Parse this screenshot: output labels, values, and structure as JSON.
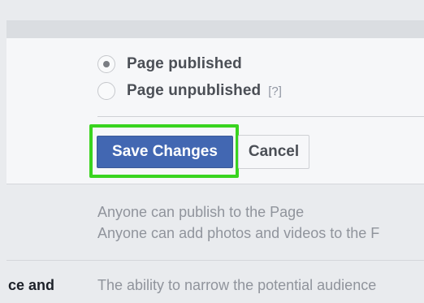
{
  "publish_setting": {
    "options": [
      {
        "label": "Page published",
        "selected": true
      },
      {
        "label": "Page unpublished",
        "selected": false,
        "help": "[?]"
      }
    ]
  },
  "actions": {
    "save_label": "Save Changes",
    "cancel_label": "Cancel"
  },
  "descriptions": {
    "line1": "Anyone can publish to the Page",
    "line2": "Anyone can add photos and videos to the F"
  },
  "audience_row": {
    "label": "ce and",
    "description": "The ability to narrow the potential audience"
  },
  "colors": {
    "primary_button": "#4267b2",
    "highlight": "#39d41f"
  }
}
